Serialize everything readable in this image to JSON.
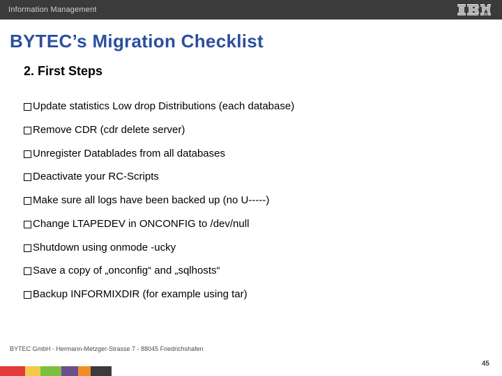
{
  "header": {
    "section_label": "Information Management",
    "logo_alt": "IBM"
  },
  "title": "BYTEC’s Migration Checklist",
  "subtitle": "2. First Steps",
  "checklist": [
    "Update statistics Low drop Distributions (each database)",
    "Remove CDR (cdr delete server)",
    "Unregister  Datablades from all databases",
    "Deactivate your RC-Scripts",
    "Make sure all logs have been backed up (no U-----)",
    "Change LTAPEDEV in ONCONFIG to /dev/null",
    "Shutdown using  onmode -ucky",
    "Save a copy of „onconfig“ and „sqlhosts“",
    "Backup INFORMIXDIR (for example using tar)"
  ],
  "footer": "BYTEC GmbH  -  Hermann-Metzger-Strasse 7  -  88045 Friedrichshafen",
  "page_number": "45"
}
